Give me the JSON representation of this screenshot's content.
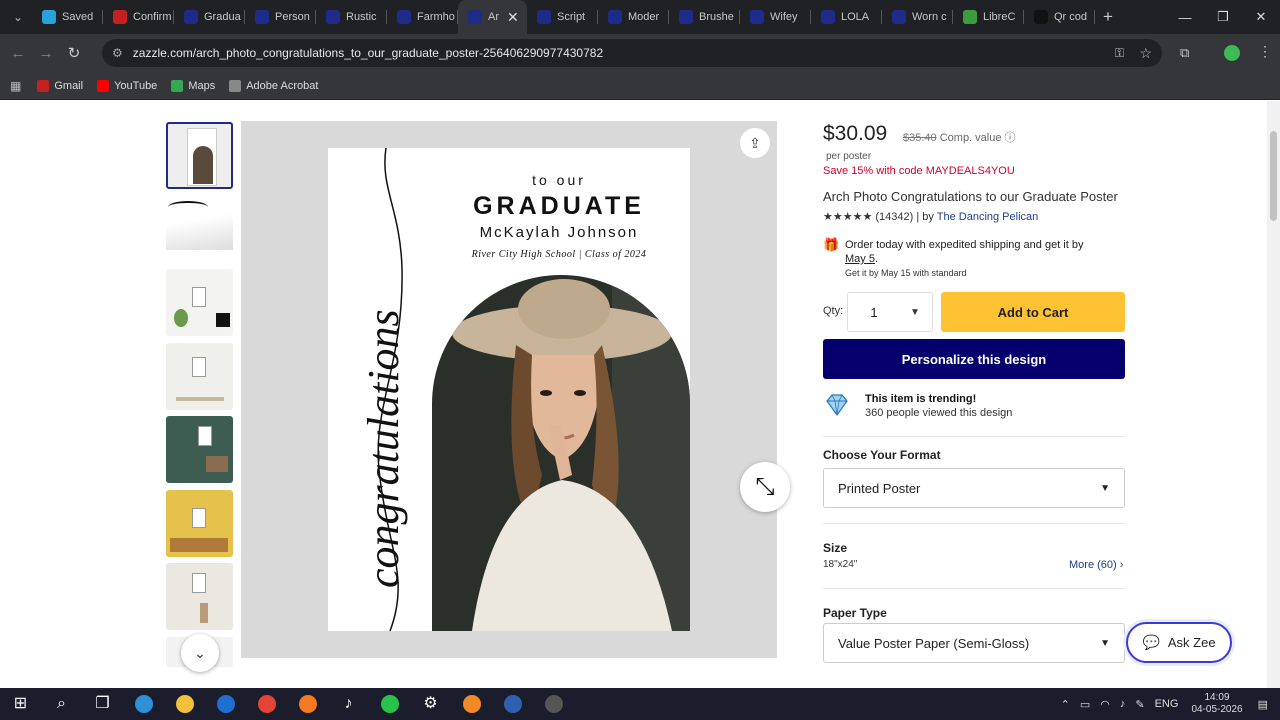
{
  "browser": {
    "tabs": [
      {
        "label": "Saved",
        "icon": "telegram-icon",
        "color": "#2aa1da"
      },
      {
        "label": "Confirm",
        "icon": "gmail-icon",
        "color": "#c5221f"
      },
      {
        "label": "Gradua",
        "icon": "zazzle-icon",
        "color": "#1e2b8a"
      },
      {
        "label": "Person",
        "icon": "zazzle-icon",
        "color": "#1e2b8a"
      },
      {
        "label": "Rustic",
        "icon": "zazzle-icon",
        "color": "#1e2b8a"
      },
      {
        "label": "Farmho",
        "icon": "zazzle-icon",
        "color": "#1e2b8a"
      },
      {
        "label": "Ar",
        "icon": "zazzle-icon",
        "color": "#1e2b8a",
        "active": true
      },
      {
        "label": "Script",
        "icon": "zazzle-icon",
        "color": "#1e2b8a"
      },
      {
        "label": "Moder",
        "icon": "zazzle-icon",
        "color": "#1e2b8a"
      },
      {
        "label": "Brushe",
        "icon": "zazzle-icon",
        "color": "#1e2b8a"
      },
      {
        "label": "Wifey",
        "icon": "zazzle-icon",
        "color": "#1e2b8a"
      },
      {
        "label": "LOLA",
        "icon": "zazzle-icon",
        "color": "#1e2b8a"
      },
      {
        "label": "Worn c",
        "icon": "zazzle-icon",
        "color": "#1e2b8a"
      },
      {
        "label": "LibreC",
        "icon": "libreoffice-icon",
        "color": "#3d9c3d"
      },
      {
        "label": "Qr cod",
        "icon": "qr-icon",
        "color": "#111"
      }
    ],
    "url": "zazzle.com/arch_photo_congratulations_to_our_graduate_poster-256406290977430782",
    "bookmarks": [
      {
        "label": "Gmail",
        "icon": "gmail-icon",
        "color": "#c5221f"
      },
      {
        "label": "YouTube",
        "icon": "youtube-icon",
        "color": "#ff0000"
      },
      {
        "label": "Maps",
        "icon": "maps-icon",
        "color": "#34a853"
      },
      {
        "label": "Adobe Acrobat",
        "icon": "globe-icon",
        "color": "#888"
      }
    ]
  },
  "poster": {
    "to_our": "to our",
    "graduate": "GRADUATE",
    "name": "McKaylah Johnson",
    "school": "River City High School | Class of 2024",
    "script_word": "congratulations"
  },
  "product": {
    "price": "$30.09",
    "compare_price": "$35.40",
    "compare_label": "Comp. value",
    "unit": "per poster",
    "promo": "Save 15% with code MAYDEALS4YOU",
    "title": "Arch Photo Congratulations to our Graduate Poster",
    "stars": "★★★★★",
    "reviews": "(14342)",
    "by": "| by",
    "seller": "The Dancing Pelican",
    "shipping_line1": "Order today with expedited shipping and get it by",
    "shipping_date": "May 5",
    "shipping_line2": "Get it by May 15 with standard",
    "qty_label": "Qty:",
    "qty_value": "1",
    "add_to_cart": "Add to Cart",
    "personalize": "Personalize this design",
    "trending_title": "This item is trending!",
    "trending_sub": "360 people viewed this design",
    "format_label": "Choose Your Format",
    "format_value": "Printed Poster",
    "size_label": "Size",
    "size_value": "18\"x24\"",
    "size_more": "More (60)",
    "paper_label": "Paper Type",
    "paper_value": "Value Poster Paper (Semi-Gloss)",
    "ask_zee": "Ask Zee"
  },
  "taskbar": {
    "apps": [
      "windows-start-icon",
      "search-icon",
      "task-view-icon",
      "edge-icon",
      "file-explorer-icon",
      "outlook-icon",
      "chrome-icon",
      "firefox-icon",
      "tiktok-icon",
      "whatsapp-icon",
      "settings-icon",
      "blender-icon",
      "app-icon",
      "obs-icon"
    ],
    "language": "ENG",
    "time": "14:09",
    "date": "04-05-2026"
  }
}
